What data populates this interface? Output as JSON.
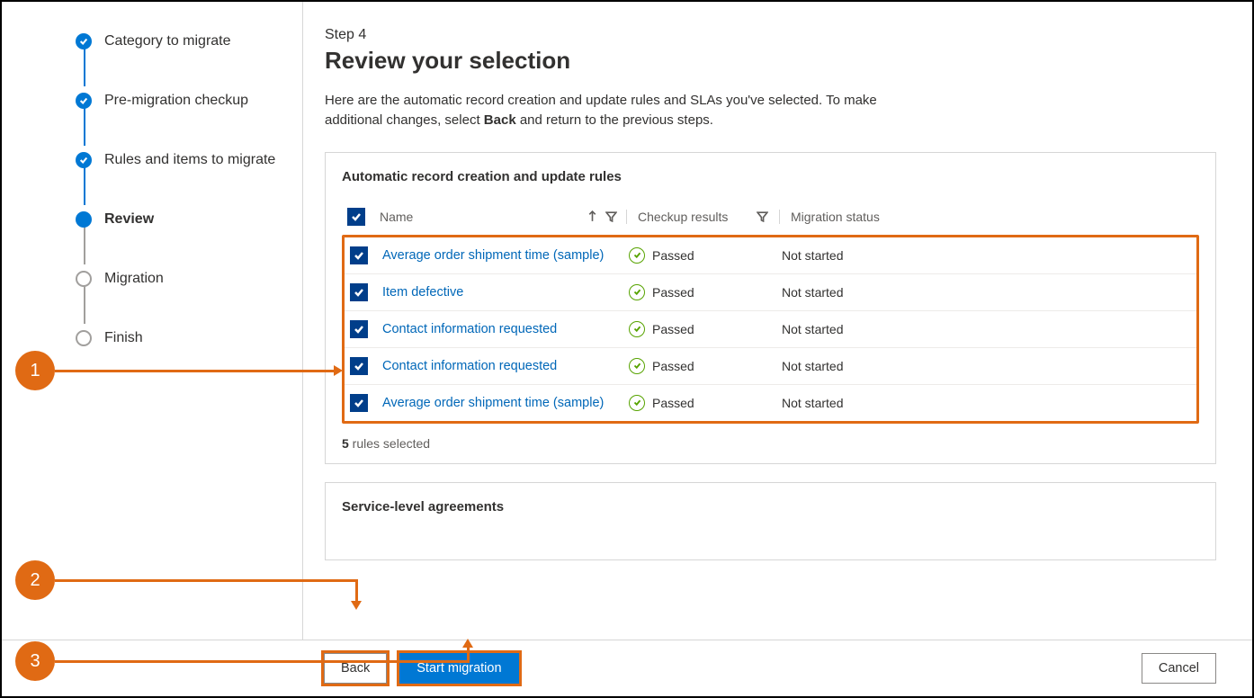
{
  "stepper": {
    "items": [
      {
        "label": "Category to migrate",
        "state": "done"
      },
      {
        "label": "Pre-migration checkup",
        "state": "done"
      },
      {
        "label": "Rules and items to migrate",
        "state": "done"
      },
      {
        "label": "Review",
        "state": "current"
      },
      {
        "label": "Migration",
        "state": "todo"
      },
      {
        "label": "Finish",
        "state": "todo"
      }
    ]
  },
  "header": {
    "kicker": "Step 4",
    "title": "Review your selection",
    "intro_before": "Here are the automatic record creation and update rules and SLAs you've selected. To make additional changes, select ",
    "intro_bold": "Back",
    "intro_after": " and return to the previous steps."
  },
  "rules_card": {
    "title": "Automatic record creation and update rules",
    "columns": {
      "name": "Name",
      "checkup": "Checkup results",
      "migration": "Migration status"
    },
    "rows": [
      {
        "name": "Average order shipment time (sample)",
        "result": "Passed",
        "status": "Not started"
      },
      {
        "name": "Item defective",
        "result": "Passed",
        "status": "Not started"
      },
      {
        "name": "Contact information requested",
        "result": "Passed",
        "status": "Not started"
      },
      {
        "name": "Contact information requested",
        "result": "Passed",
        "status": "Not started"
      },
      {
        "name": "Average order shipment time (sample)",
        "result": "Passed",
        "status": "Not started"
      }
    ],
    "selected_count": "5",
    "selected_suffix": " rules selected"
  },
  "sla_card": {
    "title": "Service-level agreements"
  },
  "footer": {
    "back": "Back",
    "start": "Start migration",
    "cancel": "Cancel"
  },
  "callouts": {
    "c1": "1",
    "c2": "2",
    "c3": "3"
  }
}
